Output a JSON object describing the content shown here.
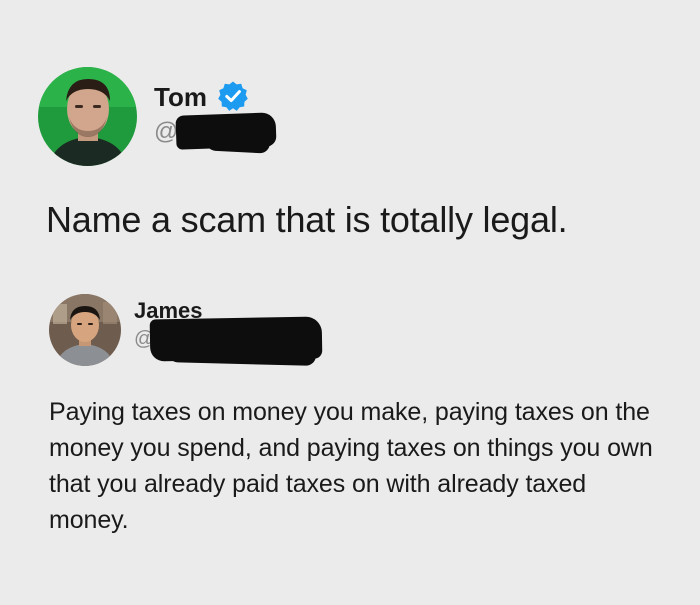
{
  "posts": [
    {
      "author": {
        "name": "Tom",
        "handle": "@",
        "verified": true
      },
      "text": "Name a scam that is totally legal."
    },
    {
      "author": {
        "name": "James",
        "handle": "@",
        "verified": false
      },
      "text": "Paying taxes on money you make, paying taxes on the money you spend, and paying taxes on things you own that you already paid taxes on with already taxed money."
    }
  ],
  "colors": {
    "background": "#ebebeb",
    "text": "#1a1a1a",
    "handle": "#8a8a8a",
    "verified": "#1d9bf0",
    "redaction": "#0d0d0d"
  },
  "icons": {
    "verified": "verified-badge-icon"
  }
}
